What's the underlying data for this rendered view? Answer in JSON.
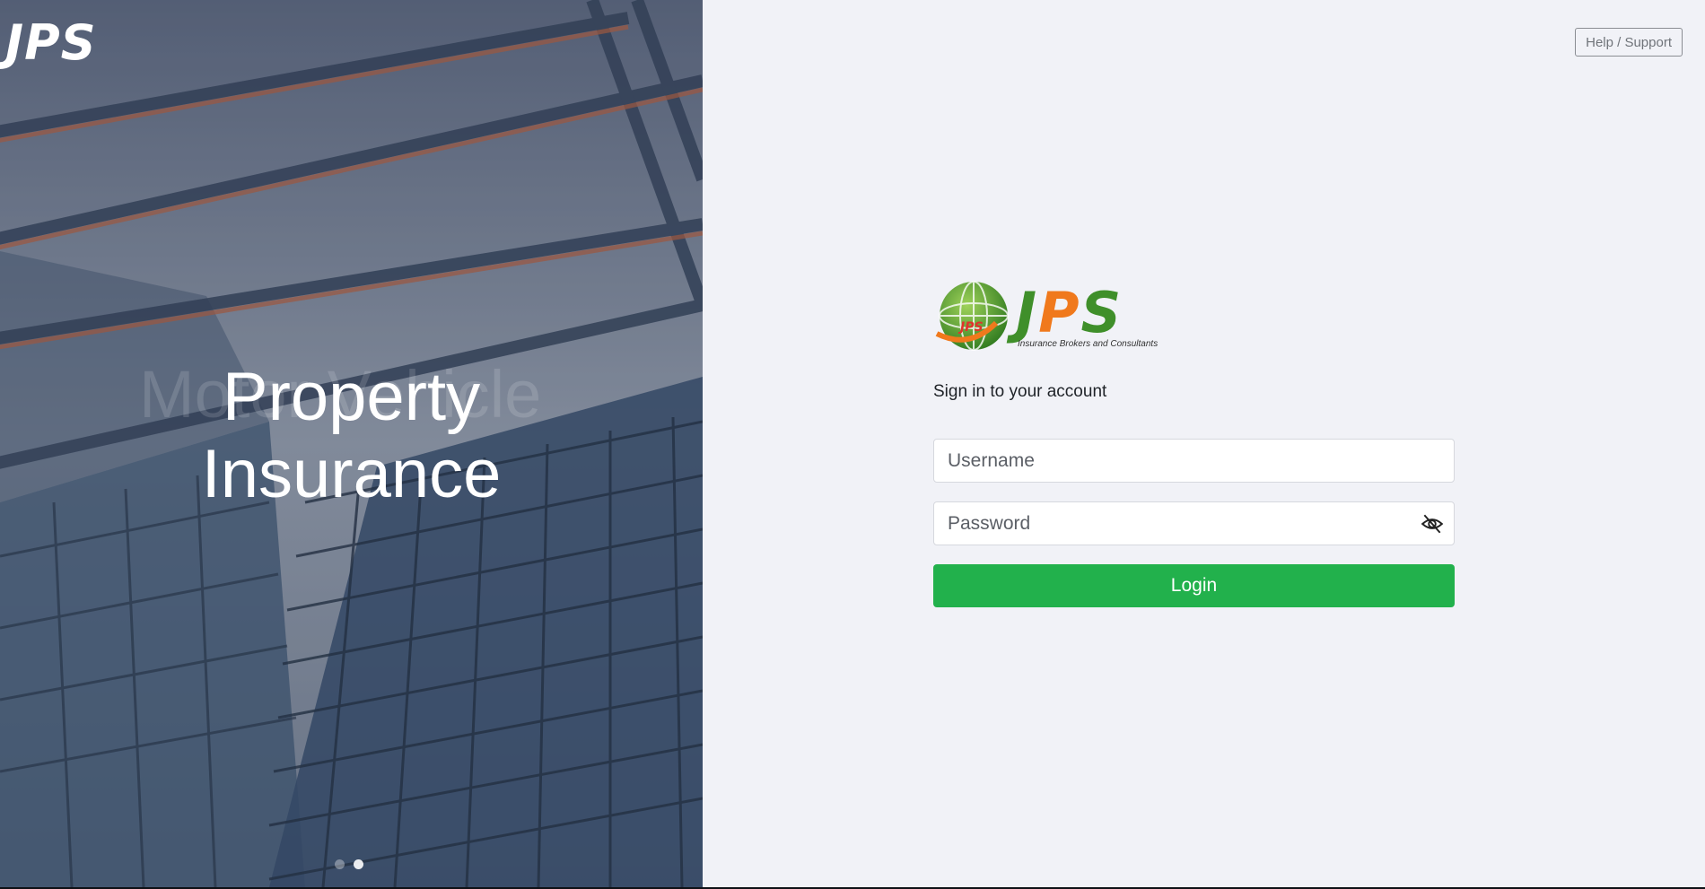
{
  "hero": {
    "logo_text": "JPS",
    "ghost_title": "Motor Vehicle",
    "slide_title_line1": "Property",
    "slide_title_line2": "Insurance",
    "slide_count": 2,
    "active_slide": 2
  },
  "header": {
    "help_label": "Help / Support"
  },
  "brand": {
    "word_j": "J",
    "word_p": "P",
    "word_s": "S",
    "globe_text": "JPS",
    "tagline": "Insurance Brokers and Consultants"
  },
  "form": {
    "heading": "Sign in to your account",
    "username_placeholder": "Username",
    "username_value": "",
    "password_placeholder": "Password",
    "password_value": "",
    "password_toggle_icon": "eye-off-icon",
    "login_label": "Login"
  },
  "colors": {
    "login_button": "#22b14c",
    "brand_green": "#3f8f2a",
    "brand_orange": "#f0791c",
    "panel_background": "#f1f2f7"
  }
}
